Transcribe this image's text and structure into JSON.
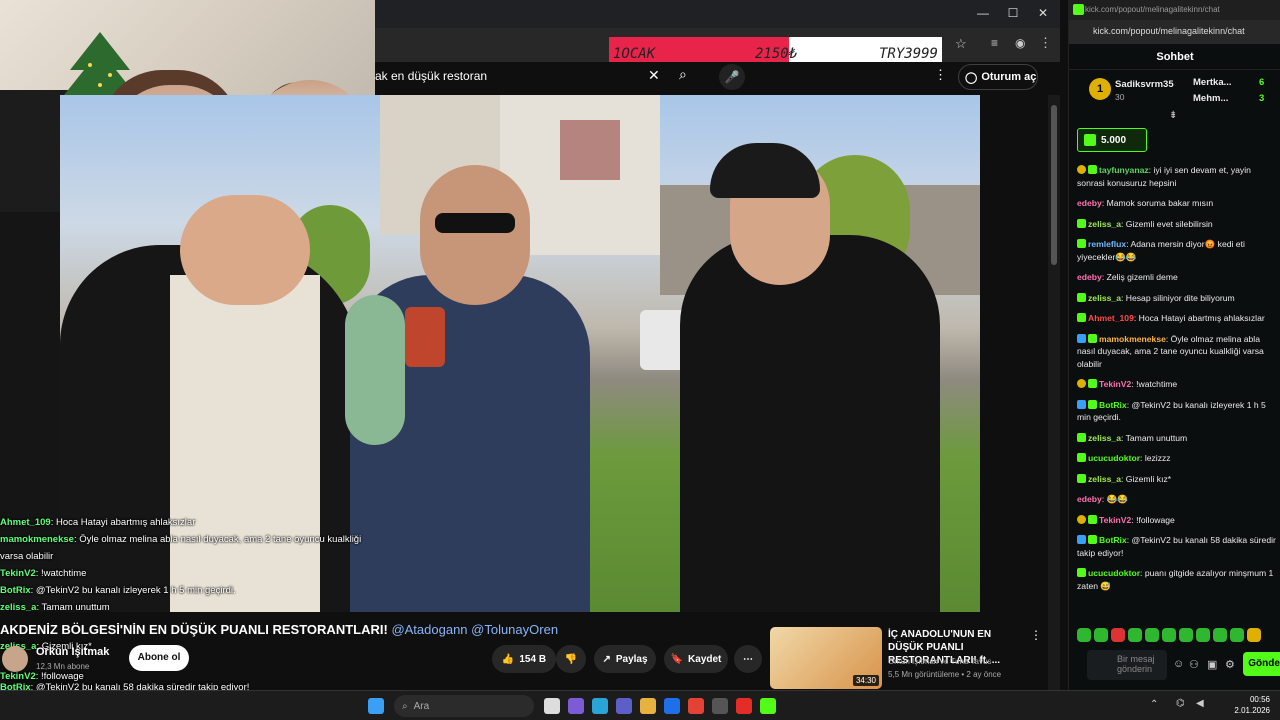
{
  "ticker": {
    "month": "1OCAK",
    "amount": "2150₺",
    "goal": "TRY3999",
    "progress": 0.54
  },
  "youtube": {
    "search_value": "ak en düşük restoran",
    "signin_label": "Oturum aç",
    "video_title": "AKDENİZ BÖLGESİ'NİN EN DÜŞÜK PUANLI RESTORANTLARI!",
    "title_tags": "@Atadogann @TolunayOren",
    "channel": "Orkun Işıtmak",
    "subs": "12,3 Mn abone",
    "subscribe_label": "Abone ol",
    "likes": "154 B",
    "share_label": "Paylaş",
    "save_label": "Kaydet",
    "rec": {
      "title": "İÇ ANADOLU'NUN EN DÜŞÜK PUANLI RESTORANTLARI! ft. ...",
      "channel": "Orkun Işıtmak ve Tuna Tavus",
      "meta": "5,5 Mn görüntüleme • 2 ay önce",
      "duration": "34:30"
    }
  },
  "overlay_chat": [
    {
      "user": "Ahmet_109",
      "text": ": Hoca Hatayi abartmış ahlaksızlar"
    },
    {
      "user": "mamokmenekse",
      "text": ": Öyle olmaz melina abla nasıl duyacak, ama 2 tane oyuncu kualkliği"
    },
    {
      "user": "",
      "text": "varsa olabilir"
    },
    {
      "user": "TekinV2",
      "text": ": !watchtime"
    },
    {
      "user": "BotRix",
      "text": ": @TekinV2 bu kanalı izleyerek 1 h 5 min geçirdi."
    },
    {
      "user": "zeliss_a",
      "text": ": Tamam unuttum"
    },
    {
      "user": "ucucudoktor",
      "text": ": lezizzz"
    },
    {
      "user": "zeliss_a",
      "text": ": Gizemli kız*"
    },
    {
      "user": "TekinV2",
      "text": ": !followage"
    }
  ],
  "overlay_bottom": [
    {
      "user": "BotRix",
      "text": ": @TekinV2 bu kanalı 58 dakika süredir takip ediyor!"
    },
    {
      "user": "ucucudoktor",
      "text": ": puanı gitgide azalıyor minşmum 1 zaten 😅"
    }
  ],
  "kick": {
    "url": "kick.com/popout/melinagalitekinn/chat",
    "header": "Sohbet",
    "leaders": [
      {
        "name": "Sadiksvrm35",
        "count": "30"
      },
      {
        "name": "Mertka...",
        "count": "6"
      },
      {
        "name": "Mehm...",
        "count": "3"
      }
    ],
    "sub_count": "5.000",
    "messages": [
      {
        "user": "tayfunyanaz",
        "color": "#5dd35d",
        "text": ": iyi iyi sen devam et, yayin sonrasi konusuruz hepsini"
      },
      {
        "user": "edeby",
        "color": "#ff6fb0",
        "text": ": Mamok soruma bakar mısın"
      },
      {
        "user": "zeliss_a",
        "color": "#a0e84a",
        "text": ": Gizemli evet silebilirsin"
      },
      {
        "user": "remleflux",
        "color": "#6fb8ff",
        "text": ": Adana mersin diyor😡 kedi eti yiyecekler😂😂"
      },
      {
        "user": "edeby",
        "color": "#ff6fb0",
        "text": ": Zeliş gizemli deme"
      },
      {
        "user": "zeliss_a",
        "color": "#a0e84a",
        "text": ": Hesap siliniyor dite biliyorum"
      },
      {
        "user": "Ahmet_109",
        "color": "#ff4848",
        "text": ": Hoca Hatayi abartmış ahlaksızlar"
      },
      {
        "user": "mamokmenekse",
        "color": "#ffb347",
        "text": ": Öyle olmaz melina abla nasıl duyacak, ama 2 tane oyuncu kualkliği varsa olabilir"
      },
      {
        "user": "TekinV2",
        "color": "#ff6fb0",
        "text": ": !watchtime"
      },
      {
        "user": "BotRix",
        "color": "#53fc18",
        "text": ": @TekinV2 bu kanalı izleyerek 1 h 5 min geçirdi."
      },
      {
        "user": "zeliss_a",
        "color": "#a0e84a",
        "text": ": Tamam unuttum"
      },
      {
        "user": "ucucudoktor",
        "color": "#53fc18",
        "text": ": lezizzz"
      },
      {
        "user": "zeliss_a",
        "color": "#a0e84a",
        "text": ": Gizemli kız*"
      },
      {
        "user": "edeby",
        "color": "#ff6fb0",
        "text": ": 😂😂"
      },
      {
        "user": "TekinV2",
        "color": "#ff6fb0",
        "text": ": !followage"
      },
      {
        "user": "BotRix",
        "color": "#53fc18",
        "text": ": @TekinV2 bu kanalı 58 dakika süredir takip ediyor!"
      },
      {
        "user": "ucucudoktor",
        "color": "#53fc18",
        "text": ": puanı gitgide azalıyor minşmum 1 zaten 😅"
      }
    ],
    "input_placeholder": "Bir mesaj gönderin",
    "send_label": "Gönder"
  },
  "taskbar": {
    "search_placeholder": "Ara",
    "time": "00:56",
    "date": "2.01.2026"
  }
}
